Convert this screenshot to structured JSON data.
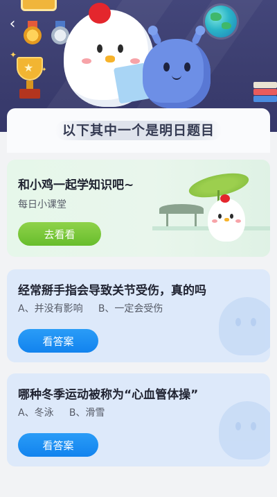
{
  "header": {
    "back_icon": "chevron-left-icon"
  },
  "title": "以下其中一个是明日题目",
  "lesson_card": {
    "title": "和小鸡一起学知识吧~",
    "subtitle": "每日小课堂",
    "button_label": "去看看",
    "accent": "#6cc02f"
  },
  "questions": [
    {
      "title": "经常掰手指会导致关节受伤，真的吗",
      "options": "A、并没有影响     B、一定会受伤",
      "button_label": "看答案"
    },
    {
      "title": "哪种冬季运动被称为“心血管体操”",
      "options": "A、冬泳     B、滑雪",
      "button_label": "看答案"
    }
  ],
  "colors": {
    "banner": "#3f4275",
    "question_card": "#dde9fa",
    "primary_button": "#1a8cf2"
  }
}
